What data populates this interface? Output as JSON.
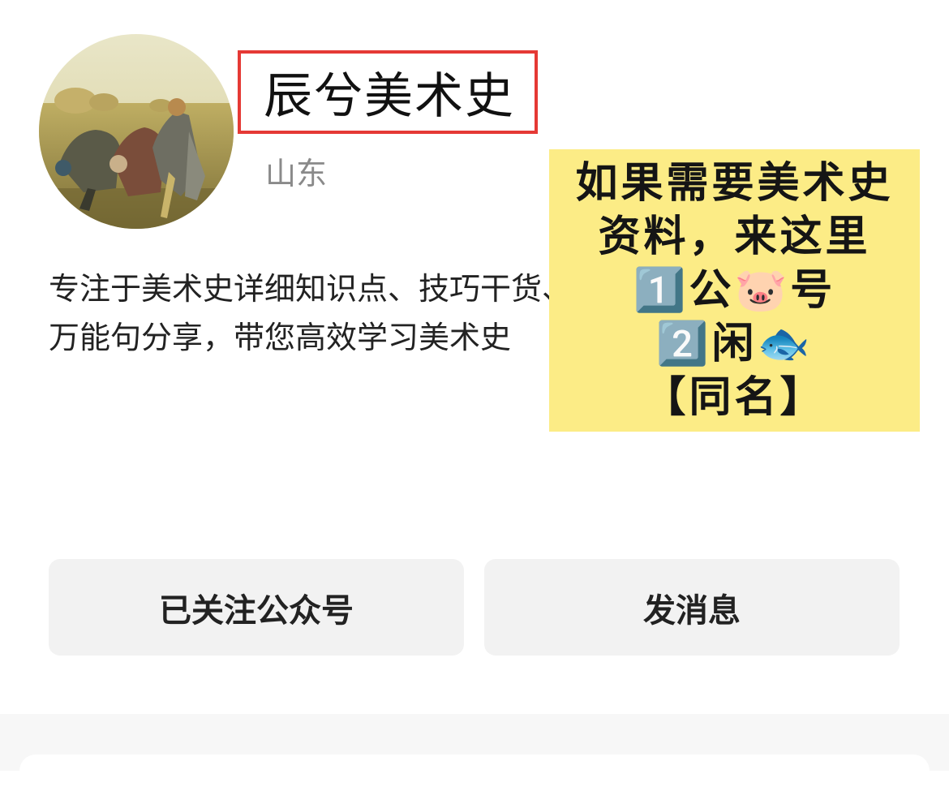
{
  "profile": {
    "name": "辰兮美术史",
    "location": "山东",
    "description_line1": "专注于美术史详细知识点、技巧干货、",
    "description_line2": "万能句分享，带您高效学习美术史"
  },
  "promo": {
    "lines": [
      "如果需要美术史",
      "资料，来这里",
      "1️⃣公🐷号",
      "2️⃣闲🐟",
      "【同名】"
    ]
  },
  "actions": {
    "follow_label": "已关注公众号",
    "message_label": "发消息"
  },
  "colors": {
    "highlight_border": "#e53935",
    "promo_background": "#fcec86",
    "button_background": "#f2f2f2"
  }
}
